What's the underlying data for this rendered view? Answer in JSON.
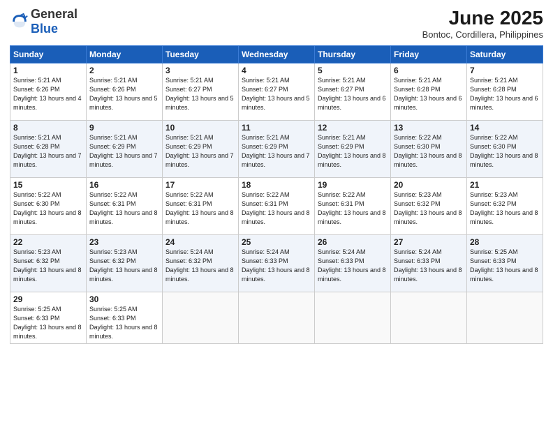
{
  "logo": {
    "general": "General",
    "blue": "Blue"
  },
  "title": {
    "month_year": "June 2025",
    "location": "Bontoc, Cordillera, Philippines"
  },
  "days_header": [
    "Sunday",
    "Monday",
    "Tuesday",
    "Wednesday",
    "Thursday",
    "Friday",
    "Saturday"
  ],
  "weeks": [
    [
      {
        "day": "1",
        "sunrise": "Sunrise: 5:21 AM",
        "sunset": "Sunset: 6:26 PM",
        "daylight": "Daylight: 13 hours and 4 minutes."
      },
      {
        "day": "2",
        "sunrise": "Sunrise: 5:21 AM",
        "sunset": "Sunset: 6:26 PM",
        "daylight": "Daylight: 13 hours and 5 minutes."
      },
      {
        "day": "3",
        "sunrise": "Sunrise: 5:21 AM",
        "sunset": "Sunset: 6:27 PM",
        "daylight": "Daylight: 13 hours and 5 minutes."
      },
      {
        "day": "4",
        "sunrise": "Sunrise: 5:21 AM",
        "sunset": "Sunset: 6:27 PM",
        "daylight": "Daylight: 13 hours and 5 minutes."
      },
      {
        "day": "5",
        "sunrise": "Sunrise: 5:21 AM",
        "sunset": "Sunset: 6:27 PM",
        "daylight": "Daylight: 13 hours and 6 minutes."
      },
      {
        "day": "6",
        "sunrise": "Sunrise: 5:21 AM",
        "sunset": "Sunset: 6:28 PM",
        "daylight": "Daylight: 13 hours and 6 minutes."
      },
      {
        "day": "7",
        "sunrise": "Sunrise: 5:21 AM",
        "sunset": "Sunset: 6:28 PM",
        "daylight": "Daylight: 13 hours and 6 minutes."
      }
    ],
    [
      {
        "day": "8",
        "sunrise": "Sunrise: 5:21 AM",
        "sunset": "Sunset: 6:28 PM",
        "daylight": "Daylight: 13 hours and 7 minutes."
      },
      {
        "day": "9",
        "sunrise": "Sunrise: 5:21 AM",
        "sunset": "Sunset: 6:29 PM",
        "daylight": "Daylight: 13 hours and 7 minutes."
      },
      {
        "day": "10",
        "sunrise": "Sunrise: 5:21 AM",
        "sunset": "Sunset: 6:29 PM",
        "daylight": "Daylight: 13 hours and 7 minutes."
      },
      {
        "day": "11",
        "sunrise": "Sunrise: 5:21 AM",
        "sunset": "Sunset: 6:29 PM",
        "daylight": "Daylight: 13 hours and 7 minutes."
      },
      {
        "day": "12",
        "sunrise": "Sunrise: 5:21 AM",
        "sunset": "Sunset: 6:29 PM",
        "daylight": "Daylight: 13 hours and 8 minutes."
      },
      {
        "day": "13",
        "sunrise": "Sunrise: 5:22 AM",
        "sunset": "Sunset: 6:30 PM",
        "daylight": "Daylight: 13 hours and 8 minutes."
      },
      {
        "day": "14",
        "sunrise": "Sunrise: 5:22 AM",
        "sunset": "Sunset: 6:30 PM",
        "daylight": "Daylight: 13 hours and 8 minutes."
      }
    ],
    [
      {
        "day": "15",
        "sunrise": "Sunrise: 5:22 AM",
        "sunset": "Sunset: 6:30 PM",
        "daylight": "Daylight: 13 hours and 8 minutes."
      },
      {
        "day": "16",
        "sunrise": "Sunrise: 5:22 AM",
        "sunset": "Sunset: 6:31 PM",
        "daylight": "Daylight: 13 hours and 8 minutes."
      },
      {
        "day": "17",
        "sunrise": "Sunrise: 5:22 AM",
        "sunset": "Sunset: 6:31 PM",
        "daylight": "Daylight: 13 hours and 8 minutes."
      },
      {
        "day": "18",
        "sunrise": "Sunrise: 5:22 AM",
        "sunset": "Sunset: 6:31 PM",
        "daylight": "Daylight: 13 hours and 8 minutes."
      },
      {
        "day": "19",
        "sunrise": "Sunrise: 5:22 AM",
        "sunset": "Sunset: 6:31 PM",
        "daylight": "Daylight: 13 hours and 8 minutes."
      },
      {
        "day": "20",
        "sunrise": "Sunrise: 5:23 AM",
        "sunset": "Sunset: 6:32 PM",
        "daylight": "Daylight: 13 hours and 8 minutes."
      },
      {
        "day": "21",
        "sunrise": "Sunrise: 5:23 AM",
        "sunset": "Sunset: 6:32 PM",
        "daylight": "Daylight: 13 hours and 8 minutes."
      }
    ],
    [
      {
        "day": "22",
        "sunrise": "Sunrise: 5:23 AM",
        "sunset": "Sunset: 6:32 PM",
        "daylight": "Daylight: 13 hours and 8 minutes."
      },
      {
        "day": "23",
        "sunrise": "Sunrise: 5:23 AM",
        "sunset": "Sunset: 6:32 PM",
        "daylight": "Daylight: 13 hours and 8 minutes."
      },
      {
        "day": "24",
        "sunrise": "Sunrise: 5:24 AM",
        "sunset": "Sunset: 6:32 PM",
        "daylight": "Daylight: 13 hours and 8 minutes."
      },
      {
        "day": "25",
        "sunrise": "Sunrise: 5:24 AM",
        "sunset": "Sunset: 6:33 PM",
        "daylight": "Daylight: 13 hours and 8 minutes."
      },
      {
        "day": "26",
        "sunrise": "Sunrise: 5:24 AM",
        "sunset": "Sunset: 6:33 PM",
        "daylight": "Daylight: 13 hours and 8 minutes."
      },
      {
        "day": "27",
        "sunrise": "Sunrise: 5:24 AM",
        "sunset": "Sunset: 6:33 PM",
        "daylight": "Daylight: 13 hours and 8 minutes."
      },
      {
        "day": "28",
        "sunrise": "Sunrise: 5:25 AM",
        "sunset": "Sunset: 6:33 PM",
        "daylight": "Daylight: 13 hours and 8 minutes."
      }
    ],
    [
      {
        "day": "29",
        "sunrise": "Sunrise: 5:25 AM",
        "sunset": "Sunset: 6:33 PM",
        "daylight": "Daylight: 13 hours and 8 minutes."
      },
      {
        "day": "30",
        "sunrise": "Sunrise: 5:25 AM",
        "sunset": "Sunset: 6:33 PM",
        "daylight": "Daylight: 13 hours and 8 minutes."
      },
      null,
      null,
      null,
      null,
      null
    ]
  ]
}
